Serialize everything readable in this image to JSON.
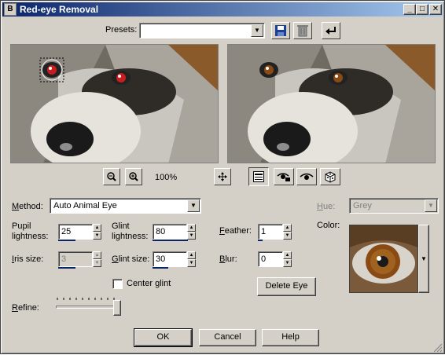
{
  "window": {
    "title": "Red-eye Removal",
    "app_icon": "B"
  },
  "titlebar_buttons": {
    "minimize": "_",
    "maximize": "□",
    "close": "✕"
  },
  "presets": {
    "label": "Presets:",
    "value": ""
  },
  "zoom": {
    "level": "100%"
  },
  "method": {
    "label": "Method:",
    "value": "Auto Animal Eye"
  },
  "hue": {
    "label": "Hue:",
    "value": "Grey"
  },
  "color": {
    "label": "Color:"
  },
  "fields": {
    "pupil_label_1": "Pupil",
    "pupil_label_2": "lightness:",
    "pupil_value": "25",
    "glint_label_1": "Glint",
    "glint_label_2": "lightness:",
    "glint_value": "80",
    "feather_label": "Feather:",
    "feather_value": "1",
    "iris_label": "Iris size:",
    "iris_value": "3",
    "glint_size_label": "Glint size:",
    "glint_size_value": "30",
    "blur_label": "Blur:",
    "blur_value": "0"
  },
  "center_glint": {
    "label": "Center glint",
    "checked": false
  },
  "delete_eye": {
    "label": "Delete Eye"
  },
  "refine": {
    "label": "Refine:",
    "level": 1.0
  },
  "buttons": {
    "ok": "OK",
    "cancel": "Cancel",
    "help": "Help"
  },
  "colors": {
    "titlebar_start": "#0a246a",
    "titlebar_end": "#a6caf0",
    "dialog_bg": "#d4d0c8",
    "eye_red": "#c81e1e",
    "eye_amber": "#8a4a14"
  }
}
